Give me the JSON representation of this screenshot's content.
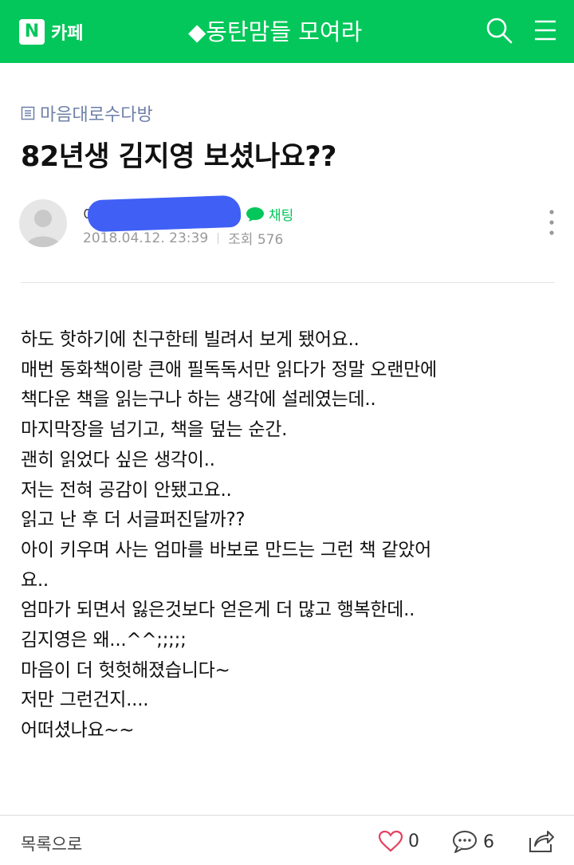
{
  "header": {
    "logo_letter": "N",
    "logo_text": "카페",
    "cafe_name": "◆동탄맘들 모여라",
    "icons": [
      "search-icon",
      "menu-icon"
    ],
    "brand_color": "#03c75a"
  },
  "post": {
    "board": "마음대로수다방",
    "title": "82년생 김지영 보셨나요??",
    "author_visible": "이",
    "chat_label": "채팅",
    "date": "2018.04.12. 23:39",
    "views": "조회 576",
    "body": [
      "하도 핫하기에 친구한테 빌려서 보게 됐어요..",
      "매번 동화책이랑 큰애 필독독서만 읽다가 정말 오랜만에",
      "책다운 책을 읽는구나 하는 생각에 설레였는데..",
      "마지막장을 넘기고, 책을 덮는 순간.",
      "괜히 읽었다 싶은 생각이..",
      "저는 전혀 공감이 안됐고요..",
      "읽고 난 후 더 서글퍼진달까??",
      "아이 키우며 사는 엄마를 바보로 만드는 그런 책 같았어",
      "요..",
      "엄마가 되면서 잃은것보다 얻은게 더 많고 행복한데..",
      "김지영은 왜...^^;;;;;",
      "마음이 더 헛헛해졌습니다~",
      "저만 그런건지....",
      "어떠셨나요~~"
    ]
  },
  "footer": {
    "list_label": "목록으로",
    "likes": "0",
    "comments": "6",
    "icons": [
      "heart-icon",
      "comment-icon",
      "share-icon"
    ]
  }
}
